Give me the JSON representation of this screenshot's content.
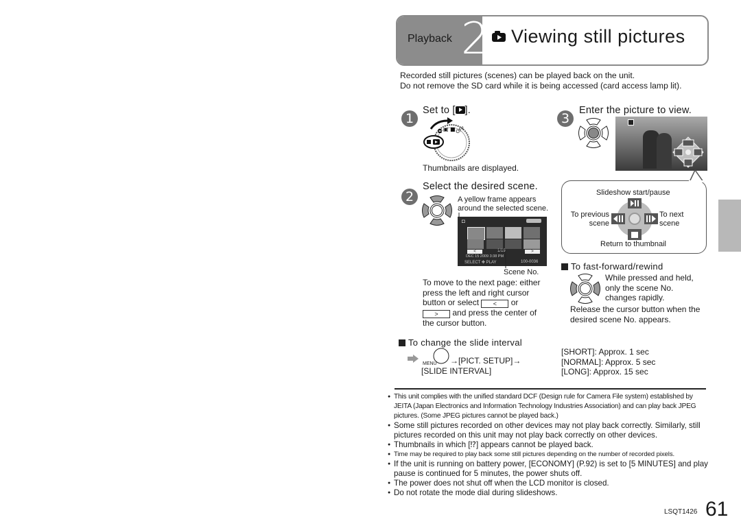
{
  "header": {
    "section": "Playback",
    "number": "2",
    "title": "Viewing still pictures",
    "icon": "playback-camera-icon"
  },
  "intro": {
    "line1": "Recorded still pictures (scenes) can be played back on the unit.",
    "line2": "Do not remove the SD card while it is being accessed (card access lamp lit)."
  },
  "step1": {
    "number": "1",
    "heading": "Set to [",
    "heading_end": "].",
    "icon": "mode-dial-icon",
    "caption": "Thumbnails are displayed."
  },
  "step2": {
    "number": "2",
    "heading": "Select the desired scene.",
    "note": "A yellow frame appears around the selected scene.",
    "screen": {
      "scene_counter": "1/19",
      "date": "DEC 15 2009",
      "time": "3:38 PM",
      "select_label": "SELECT",
      "play_label": "PLAY",
      "file_no": "100-0036",
      "prev": "<",
      "next": ">"
    },
    "scene_no_label": "Scene No.",
    "move_text_a": "To move to the next page: either press the left and right cursor button or select",
    "move_or": "or",
    "move_text_b": "and press the center of the cursor button.",
    "prev_btn": "<",
    "next_btn": ">"
  },
  "step3": {
    "number": "3",
    "heading": "Enter the picture to view.",
    "bubble": {
      "top": "Slideshow start/pause",
      "left": "To previous scene",
      "right": "To next scene",
      "bottom": "Return to thumbnail"
    }
  },
  "fast_forward": {
    "heading": "To fast-forward/rewind",
    "desc": "While pressed and held, only the scene No. changes rapidly.",
    "release": "Release the cursor button when the desired scene No. appears."
  },
  "slide_interval": {
    "heading": "To change the slide interval",
    "menu_label": "MENU",
    "path1": "→[PICT. SETUP]→",
    "path2": "[SLIDE INTERVAL]",
    "options": [
      "[SHORT]: Approx. 1 sec",
      "[NORMAL]: Approx. 5 sec",
      "[LONG]: Approx. 15 sec"
    ]
  },
  "notes": [
    "This unit complies with the unified standard DCF (Design rule for Camera File system) established by JEITA (Japan Electronics and Information Technology Industries Association) and can play back JPEG pictures. (Some JPEG pictures cannot be played back.)",
    "Some still pictures recorded on other devices may not play back correctly. Similarly, still pictures recorded on this unit may not play back correctly on other devices.",
    "Thumbnails in which [⁉] appears cannot be played back.",
    "Time may be required to play back some still pictures depending on the number of recorded pixels.",
    "If the unit is running on battery power, [ECONOMY] (P.92) is set to [5 MINUTES] and play pause is continued for 5 minutes, the power shuts off.",
    "The power does not shut off when the LCD monitor is closed.",
    "Do not rotate the mode dial during slideshows."
  ],
  "footer": {
    "code": "LSQT1426",
    "page": "61"
  }
}
